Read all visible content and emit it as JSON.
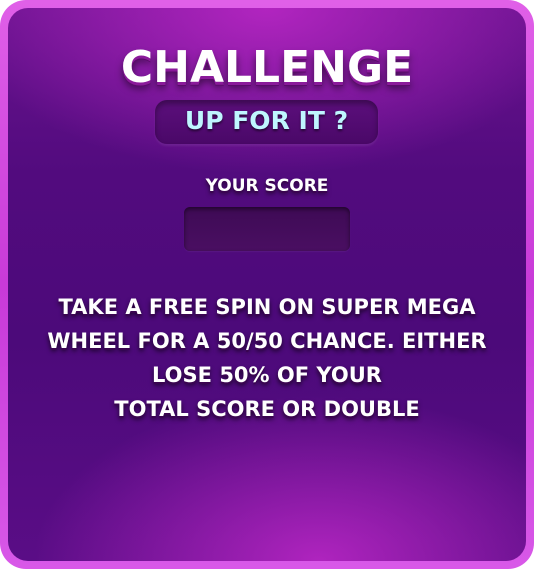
{
  "dialog": {
    "title": "CHALLENGE",
    "subtitle": "UP FOR IT ?",
    "score_label": "YOUR SCORE",
    "score_value": "",
    "description_lines": [
      "TAKE A FREE SPIN ON SUPER MEGA",
      "WHEEL FOR A 50/50 CHANCE. EITHER",
      "LOSE 50% OF YOUR",
      "TOTAL SCORE OR DOUBLE"
    ]
  },
  "colors": {
    "frame_border": "#d85ae6",
    "panel_background": "#520b7e",
    "subtitle_text": "#bff6ff",
    "title_text": "#ffffff"
  }
}
